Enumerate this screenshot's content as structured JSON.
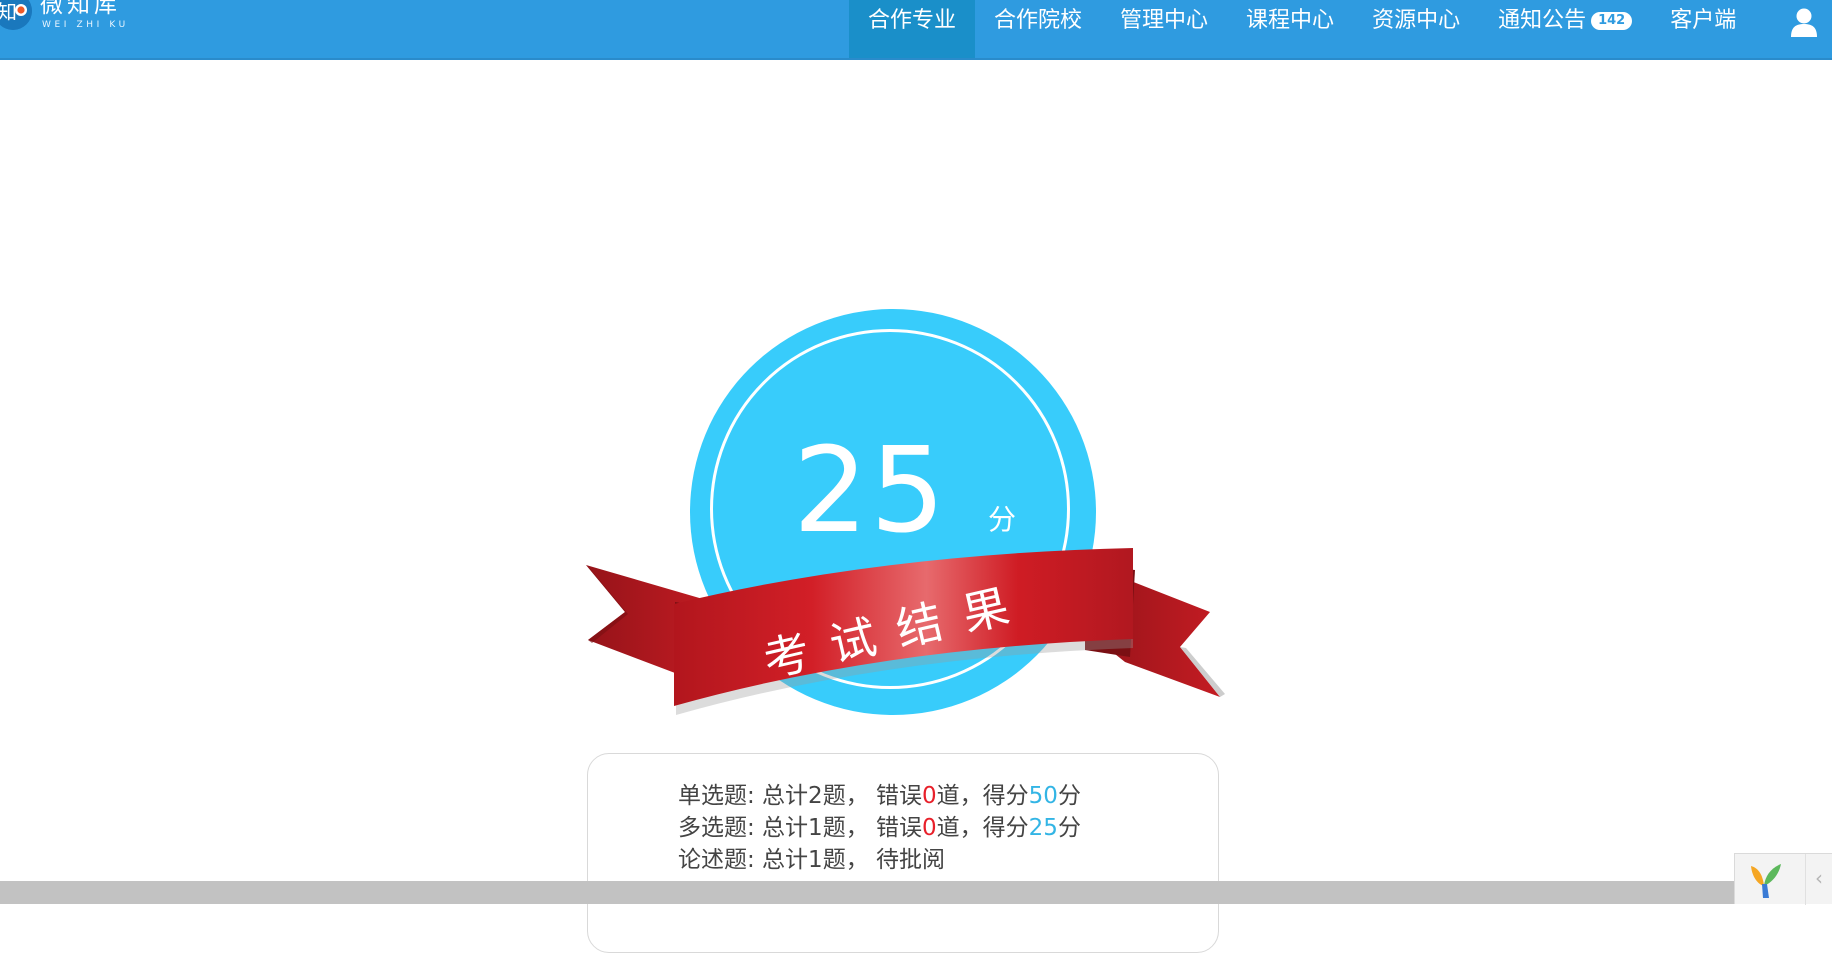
{
  "header": {
    "logo": {
      "name_cn": "微知库",
      "name_en": "WEI ZHI KU",
      "logo_glyph": "知"
    },
    "nav": [
      {
        "label": "合作专业",
        "active": true
      },
      {
        "label": "合作院校",
        "active": false
      },
      {
        "label": "管理中心",
        "active": false
      },
      {
        "label": "课程中心",
        "active": false
      },
      {
        "label": "资源中心",
        "active": false
      },
      {
        "label": "通知公告",
        "active": false,
        "badge": "142"
      },
      {
        "label": "客户端",
        "active": false
      }
    ],
    "user_icon": "user-icon",
    "colors": {
      "bar": "#2f9be0",
      "active_tab": "#1a8fc9"
    }
  },
  "score": {
    "value": "25",
    "unit": "分",
    "ribbon_text": "考试结果",
    "colors": {
      "circle": "#38ccfb",
      "ribbon": "#cc1c24"
    }
  },
  "results": {
    "rows": [
      {
        "prefix": "单选题: 总计2题， 错误",
        "wrong": "0",
        "mid": "道，得分",
        "score": "50",
        "suffix": "分"
      },
      {
        "prefix": "多选题: 总计1题， 错误",
        "wrong": "0",
        "mid": "道，得分",
        "score": "25",
        "suffix": "分"
      },
      {
        "text": "论述题: 总计1题， 待批阅"
      }
    ],
    "colors": {
      "wrong": "#e8202a",
      "score": "#33b5e5"
    }
  },
  "corner_widget": {
    "icon": "yii-logo-icon",
    "toggle_icon": "chevron-left-icon",
    "toggle_glyph": "‹"
  }
}
